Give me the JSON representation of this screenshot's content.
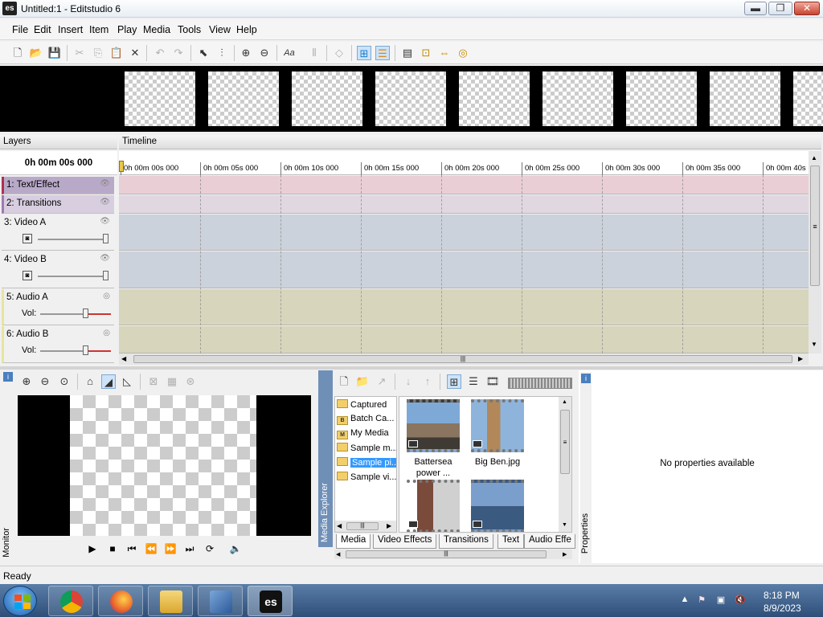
{
  "window": {
    "title": "Untitled:1 - Editstudio 6",
    "app_icon": "es",
    "min_glyph": "▬",
    "max_glyph": "❐",
    "close_glyph": "✕"
  },
  "menu": [
    "File",
    "Edit",
    "Insert",
    "Item",
    "Play",
    "Media",
    "Tools",
    "View",
    "Help"
  ],
  "toolbar_icons": {
    "new": "🗋",
    "open": "📂",
    "save": "💾",
    "cut": "✂",
    "copy": "⎘",
    "paste": "📋",
    "delete": "✕",
    "undo": "↶",
    "redo": "↷",
    "select": "⬉",
    "trim": "⫶",
    "zoom_in": "⊕",
    "zoom_out": "⊖",
    "text": "Aa",
    "split": "⫴",
    "marker": "◇",
    "snap": "⊞",
    "ripple": "☰",
    "film": "▤",
    "fit": "⊡",
    "link": "⇔",
    "target": "◎"
  },
  "layers": {
    "header": "Layers",
    "time": "0h 00m 00s 000",
    "items": [
      {
        "label": "1: Text/Effect"
      },
      {
        "label": "2: Transitions"
      },
      {
        "label": "3: Video A"
      },
      {
        "label": "4: Video B"
      },
      {
        "label": "5: Audio A",
        "vol_label": "Vol:"
      },
      {
        "label": "6: Audio B",
        "vol_label": "Vol:"
      }
    ],
    "eye_glyph": "👁",
    "audio_glyph": "◎",
    "video_ctrl_glyph": "◙"
  },
  "timeline": {
    "header": "Timeline",
    "ticks": [
      "0h 00m 00s 000",
      "0h 00m 05s 000",
      "0h 00m 10s 000",
      "0h 00m 15s 000",
      "0h 00m 20s 000",
      "0h 00m 25s 000",
      "0h 00m 30s 000",
      "0h 00m 35s 000",
      "0h 00m 40s"
    ],
    "scroll_grip": "≡",
    "up_arrow": "▲",
    "down_arrow": "▼",
    "left_arrow": "◀",
    "right_arrow": "▶",
    "hgrip": "|||"
  },
  "monitor": {
    "side_label": "Monitor",
    "tool_icons": {
      "zoom_in": "⊕",
      "zoom_out": "⊖",
      "zoom_fit": "⊙",
      "stairs": "⌂",
      "curve_active": "◢",
      "curve": "◺",
      "grid1": "⊠",
      "grid2": "▦",
      "grid3": "⊛"
    },
    "controls": {
      "play": "▶",
      "stop": "■",
      "start": "⏮",
      "rewind": "⏪",
      "forward": "⏩",
      "end": "⏭",
      "loop": "⟳",
      "volume": "🔈"
    }
  },
  "media_explorer": {
    "side_label": "Media Explorer",
    "tool_icons": {
      "new": "🗋",
      "folder": "📁",
      "import": "↗",
      "down": "↓",
      "up": "↑",
      "thumbs": "⊞",
      "list": "☰",
      "film": "🎞"
    },
    "folders": [
      {
        "label": "Captured",
        "ico": ""
      },
      {
        "label": "Batch Ca...",
        "ico": "B"
      },
      {
        "label": "My Media",
        "ico": "M"
      },
      {
        "label": "Sample m...",
        "ico": ""
      },
      {
        "label": "Sample pi...",
        "ico": ""
      },
      {
        "label": "Sample vi...",
        "ico": ""
      }
    ],
    "thumbs": [
      {
        "caption": "Battersea power ..."
      },
      {
        "caption": "Big Ben.jpg"
      },
      {
        "caption": ""
      },
      {
        "caption": ""
      }
    ],
    "tabs": [
      "Media",
      "Video Effects",
      "Transitions",
      "Text",
      "Audio Effe"
    ]
  },
  "properties": {
    "side_label": "Properties",
    "empty_text": "No properties available",
    "pin_glyph": "i"
  },
  "status": {
    "text": "Ready"
  },
  "taskbar": {
    "tasks": [
      {
        "name": "chrome"
      },
      {
        "name": "firefox"
      },
      {
        "name": "explorer"
      },
      {
        "name": "network"
      },
      {
        "name": "editstudio",
        "label": "es"
      }
    ],
    "tray": {
      "arrow": "▲",
      "flag": "⚑",
      "network": "▣",
      "volume": "🔇"
    },
    "time": "8:18 PM",
    "date": "8/9/2023"
  },
  "colors": {
    "layer_text_effect": "#d9b8c2",
    "layer_transitions": "#d7c4d4",
    "layer_video": "#c9ccd6",
    "layer_audio": "#cfccb2",
    "accent_selected": "#3399ff"
  }
}
